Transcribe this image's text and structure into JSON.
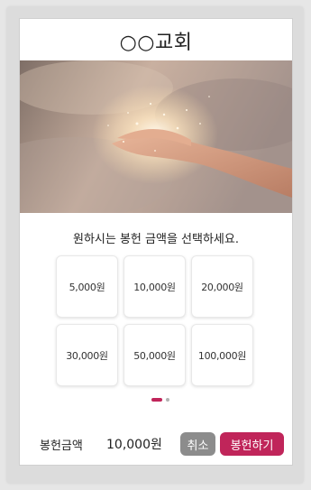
{
  "header": {
    "title": "○○교회"
  },
  "banner": {
    "image": "open-hands-in-light-image"
  },
  "offering": {
    "prompt": "원하시는 봉헌 금액을 선택하세요.",
    "amounts": [
      "5,000원",
      "10,000원",
      "20,000원",
      "30,000원",
      "50,000원",
      "100,000원"
    ]
  },
  "pagination": {
    "current": 1,
    "total": 2
  },
  "footer": {
    "label": "봉헌금액",
    "value": "10,000원",
    "cancel_label": "취소",
    "submit_label": "봉헌하기"
  },
  "colors": {
    "accent": "#c0255a",
    "cancel": "#8c8c8c",
    "background": "#e6e6e6"
  }
}
